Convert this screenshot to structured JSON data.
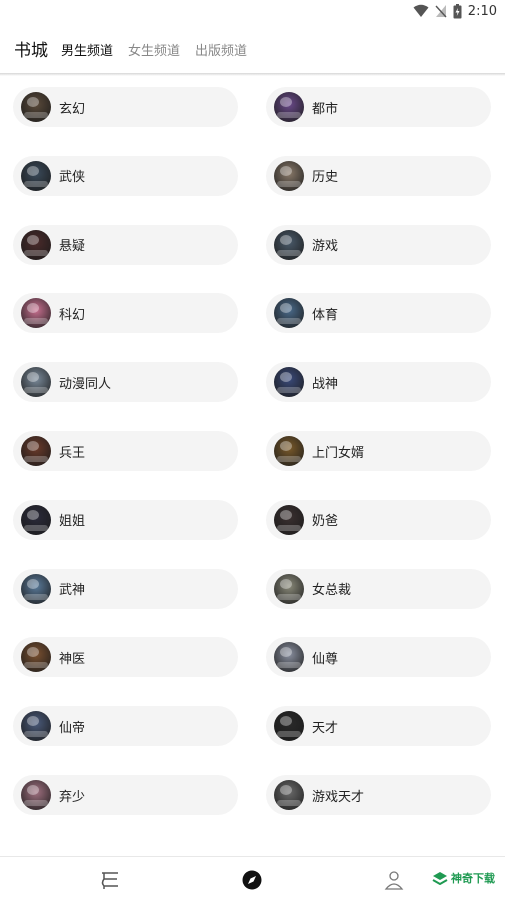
{
  "status_bar": {
    "time": "2:10",
    "icons": [
      "wifi-icon",
      "no-signal-icon",
      "battery-icon"
    ]
  },
  "header": {
    "title": "书城",
    "tabs": [
      {
        "label": "男生频道",
        "active": true
      },
      {
        "label": "女生频道",
        "active": false
      },
      {
        "label": "出版频道",
        "active": false
      }
    ]
  },
  "categories": [
    {
      "label": "玄幻",
      "color": "#5a4a3a"
    },
    {
      "label": "都市",
      "color": "#6a4a8a"
    },
    {
      "label": "武侠",
      "color": "#3a4a5a"
    },
    {
      "label": "历史",
      "color": "#8a7a6a"
    },
    {
      "label": "悬疑",
      "color": "#4a2a2a"
    },
    {
      "label": "游戏",
      "color": "#4a5a6a"
    },
    {
      "label": "科幻",
      "color": "#c87090"
    },
    {
      "label": "体育",
      "color": "#4a6a8a"
    },
    {
      "label": "动漫同人",
      "color": "#7a8a9a"
    },
    {
      "label": "战神",
      "color": "#3a4a7a"
    },
    {
      "label": "兵王",
      "color": "#6a3a2a"
    },
    {
      "label": "上门女婿",
      "color": "#7a5a2a"
    },
    {
      "label": "姐姐",
      "color": "#2a2a3a"
    },
    {
      "label": "奶爸",
      "color": "#3a3030"
    },
    {
      "label": "武神",
      "color": "#5a7a9a"
    },
    {
      "label": "女总裁",
      "color": "#8a8a7a"
    },
    {
      "label": "神医",
      "color": "#7a5030"
    },
    {
      "label": "仙尊",
      "color": "#8a90a0"
    },
    {
      "label": "仙帝",
      "color": "#4a5a7a"
    },
    {
      "label": "天才",
      "color": "#2a2a2a"
    },
    {
      "label": "弃少",
      "color": "#a07080"
    },
    {
      "label": "游戏天才",
      "color": "#6a6a6a"
    }
  ],
  "bottom_nav": [
    {
      "name": "bookshelf-icon"
    },
    {
      "name": "discover-compass-icon",
      "active": true
    },
    {
      "name": "profile-icon"
    }
  ],
  "watermark": {
    "text": "神奇下载"
  },
  "colors": {
    "pill_bg": "#f4f4f4",
    "brand_green": "#1f9a52"
  }
}
